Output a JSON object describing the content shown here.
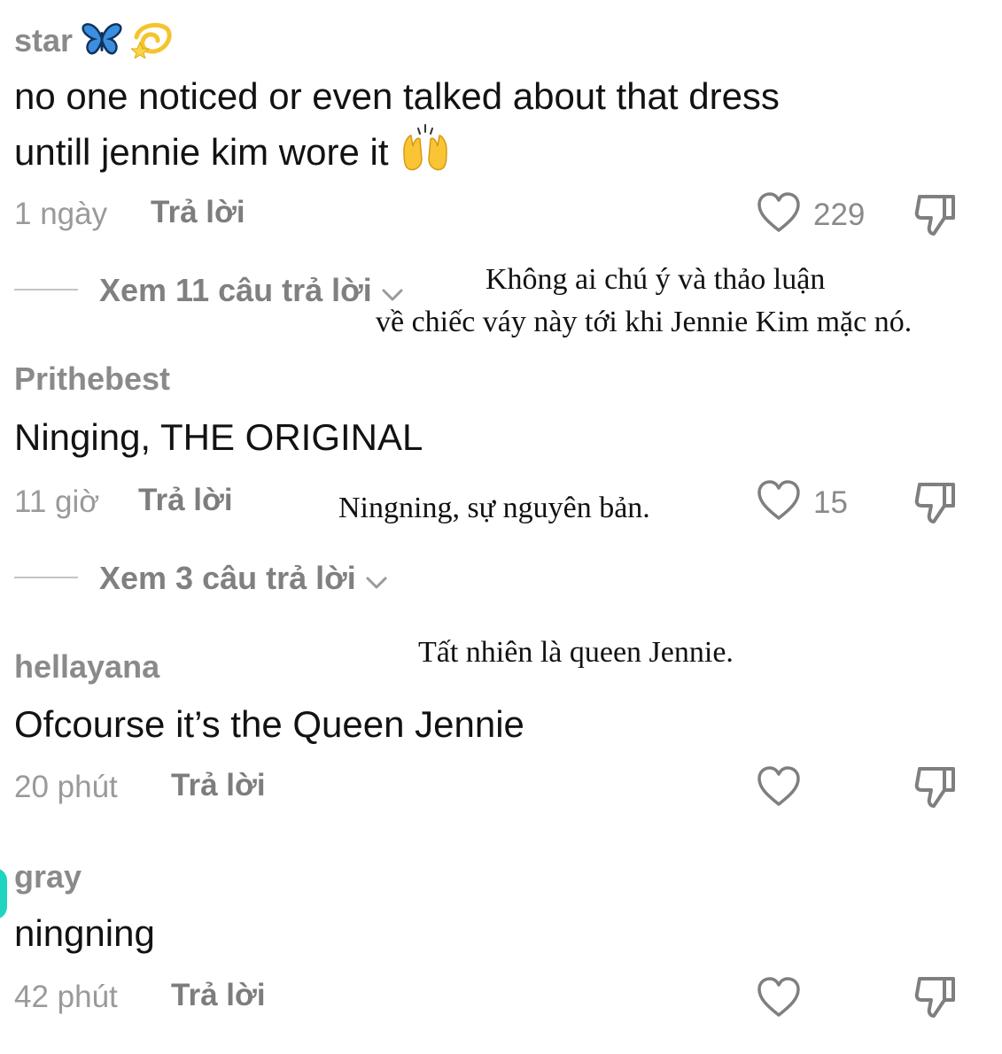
{
  "comments": [
    {
      "username": "star",
      "username_emoji": [
        "butterfly-emoji",
        "dizzy-emoji"
      ],
      "text_line1": "no one noticed or even talked about that dress",
      "text_line2": "untill jennie kim wore it",
      "text_emoji": "raising-hands-emoji",
      "time": "1 ngày",
      "reply_label": "Trả lời",
      "likes": "229",
      "view_replies": "Xem 11 câu trả lời"
    },
    {
      "username": "Prithebest",
      "text": "Ninging, THE ORIGINAL",
      "time": "11 giờ",
      "reply_label": "Trả lời",
      "likes": "15",
      "view_replies": "Xem 3 câu trả lời"
    },
    {
      "username": "hellayana",
      "text": "Ofcourse it’s the Queen Jennie",
      "time": "20 phút",
      "reply_label": "Trả lời",
      "likes": ""
    },
    {
      "username": "gray",
      "text": "ningning",
      "time": "42 phút",
      "reply_label": "Trả lời",
      "likes": ""
    }
  ],
  "translations": {
    "t1_line1": "Không ai chú ý và thảo luận",
    "t1_line2": "về chiếc váy này tới khi Jennie Kim mặc nó.",
    "t2": "Ningning, sự nguyên bản.",
    "t3": "Tất nhiên là queen Jennie."
  },
  "colors": {
    "accent": "#20d5bf",
    "text": "#121212",
    "muted": "#9a9a9a"
  }
}
